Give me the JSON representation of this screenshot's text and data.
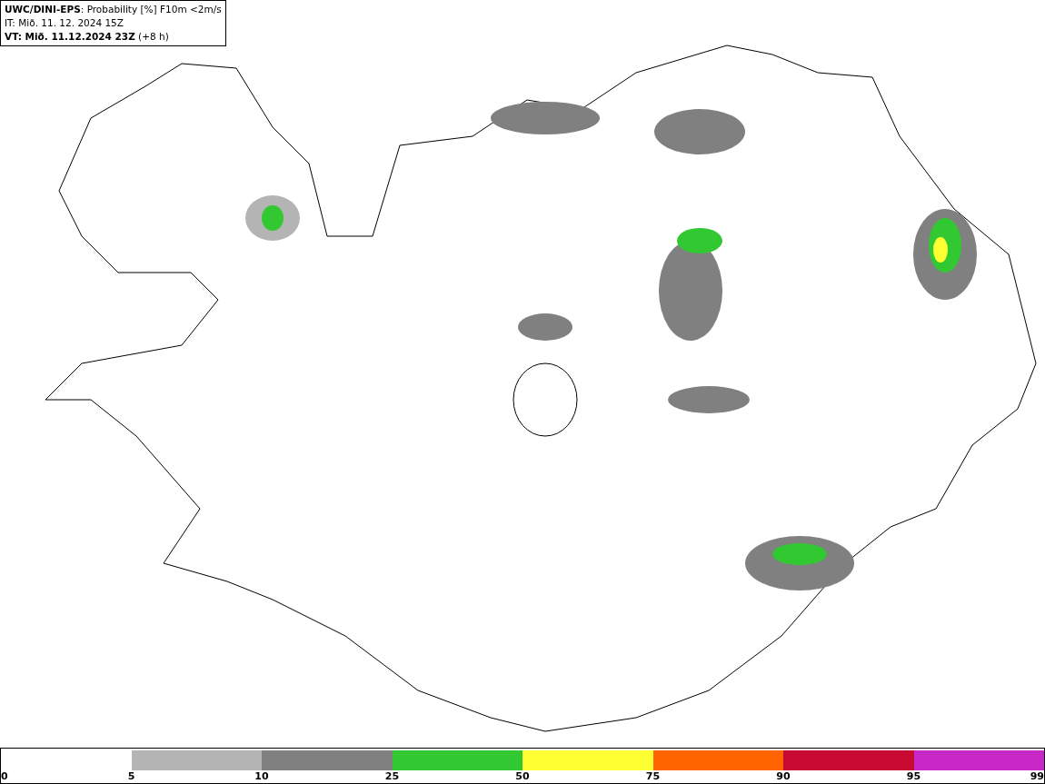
{
  "header": {
    "title": "**UWC/DINI-EPS**: Probability [%] F10m <2m/s",
    "init_time": "IT: Mið. 11. 12. 2024 15Z",
    "valid_time": "**VT: Mið. 11.12.2024 23Z** (+8 h)"
  },
  "legend": {
    "segments": [
      {
        "label": "0"
      },
      {
        "label": "5",
        "color": "#b4b4b4"
      },
      {
        "label": "10",
        "color": "#808080"
      },
      {
        "label": "25",
        "color": "#32c832"
      },
      {
        "label": "50",
        "color": "#ffff32"
      },
      {
        "label": "75",
        "color": "#ff6400"
      },
      {
        "label": "90",
        "color": "#c80a32"
      },
      {
        "label": "95",
        "color": "#c828c8"
      }
    ],
    "max_label": "99"
  }
}
